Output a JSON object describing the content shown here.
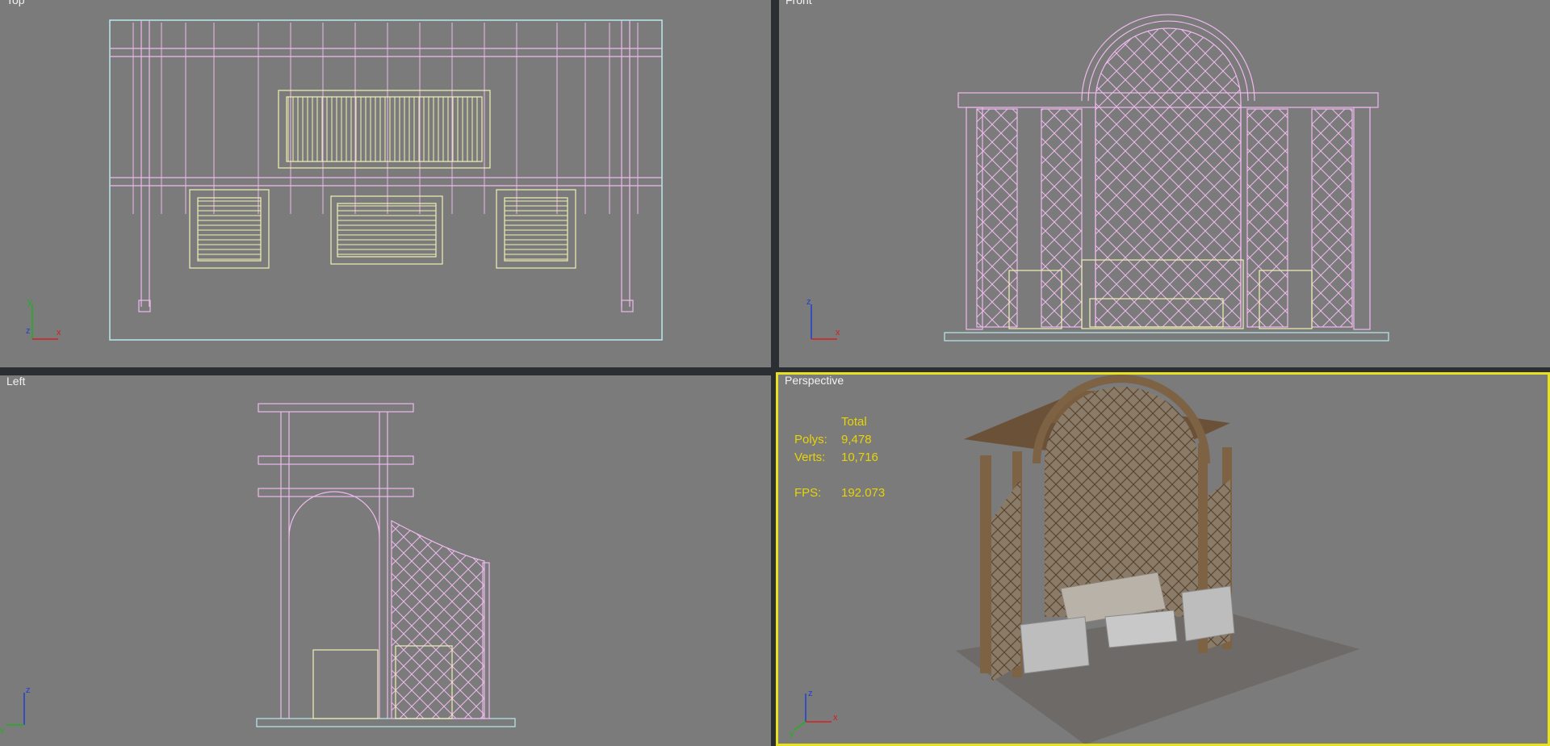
{
  "viewports": {
    "top": {
      "label": "Top"
    },
    "front": {
      "label": "Front"
    },
    "left": {
      "label": "Left"
    },
    "perspective": {
      "label": "Perspective"
    }
  },
  "stats": {
    "header": "Total",
    "polys_label": "Polys:",
    "polys_value": "9,478",
    "verts_label": "Verts:",
    "verts_value": "10,716",
    "fps_label": "FPS:",
    "fps_value": "192.073"
  },
  "axes": {
    "top": {
      "v": "y",
      "z": "z",
      "h": "x"
    },
    "front": {
      "v": "z",
      "h": "x"
    },
    "left": {
      "v": "z",
      "h": "y"
    },
    "persp": {
      "v": "z",
      "h": "x",
      "d": "y"
    }
  },
  "colors": {
    "viewport_bg": "#7b7b7b",
    "wire_pink": "#efb9ee",
    "wire_yellow": "#f0f0b4",
    "bbox_cyan": "#b7eaf0",
    "active_border": "#e7e21d",
    "stats_text": "#e8d400",
    "axis_x": "#d42020",
    "axis_y": "#20b020",
    "axis_z": "#2040d0"
  }
}
